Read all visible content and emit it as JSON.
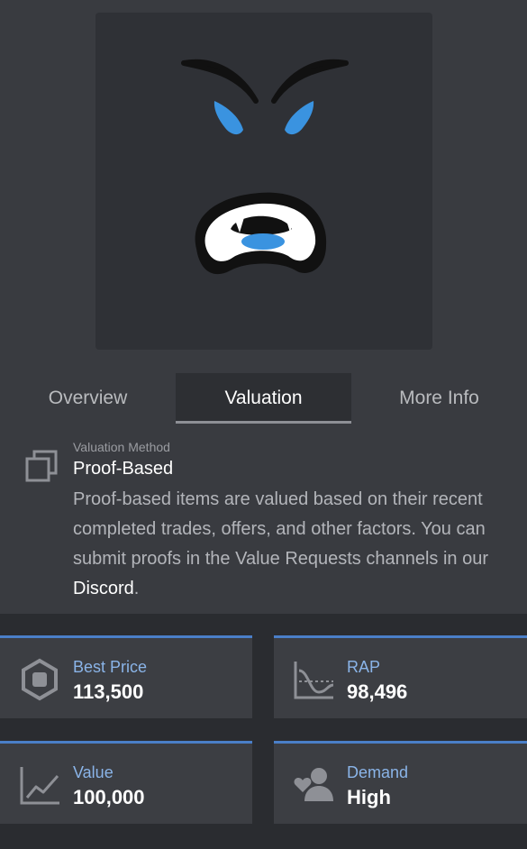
{
  "item": {
    "image_icon": "angry-face-item-thumbnail"
  },
  "tabs": [
    {
      "label": "Overview",
      "active": false
    },
    {
      "label": "Valuation",
      "active": true
    },
    {
      "label": "More Info",
      "active": false
    }
  ],
  "valuation": {
    "method_label": "Valuation Method",
    "method_title": "Proof-Based",
    "method_icon": "copy-icon",
    "description": "Proof-based items are valued based on their recent completed trades, offers, and other factors. You can submit proofs in the Value Requests channels in our ",
    "link_text": "Discord",
    "description_end": "."
  },
  "stats": [
    {
      "label": "Best Price",
      "value": "113,500",
      "icon": "robux-icon"
    },
    {
      "label": "RAP",
      "value": "98,496",
      "icon": "rap-chart-icon"
    },
    {
      "label": "Value",
      "value": "100,000",
      "icon": "line-chart-icon"
    },
    {
      "label": "Demand",
      "value": "High",
      "icon": "users-heart-icon"
    }
  ],
  "colors": {
    "accent": "#4a7fc8",
    "stat_label": "#8ab4e8",
    "background": "#393b40"
  }
}
